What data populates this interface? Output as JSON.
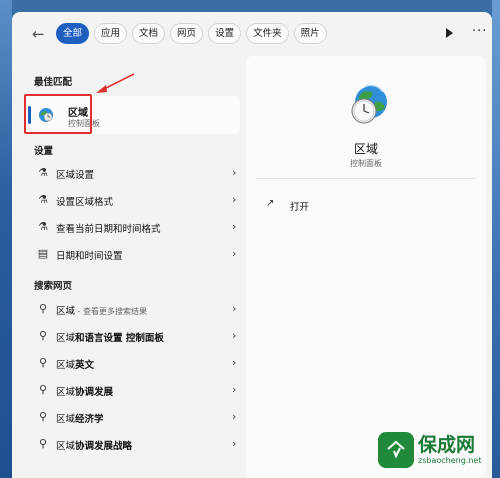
{
  "tabs": [
    "全部",
    "应用",
    "文档",
    "网页",
    "设置",
    "文件夹",
    "照片"
  ],
  "active_tab": "全部",
  "toolbar": {
    "more_label": "···"
  },
  "best_match": {
    "section_title": "最佳匹配",
    "title": "区域",
    "subtitle": "控制面板"
  },
  "settings": {
    "section_title": "设置",
    "items": [
      {
        "label": "区域设置",
        "icon": "region-settings-icon"
      },
      {
        "label": "设置区域格式",
        "icon": "region-format-icon"
      },
      {
        "label": "查看当前日期和时间格式",
        "icon": "datetime-format-icon"
      },
      {
        "label": "日期和时间设置",
        "icon": "calendar-clock-icon"
      }
    ]
  },
  "web": {
    "section_title": "搜索网页",
    "items": [
      {
        "main": "区域",
        "hint": " - 查看更多搜索结果"
      },
      {
        "main": "区域",
        "bold": "和语言设置 控制面板"
      },
      {
        "main": "区域",
        "bold": "英文"
      },
      {
        "main": "区域",
        "bold": "协调发展"
      },
      {
        "main": "区域",
        "bold": "经济学"
      },
      {
        "main": "区域",
        "bold": "协调发展战略"
      }
    ]
  },
  "detail": {
    "title": "区域",
    "subtitle": "控制面板",
    "open_label": "打开"
  },
  "watermark": {
    "text": "保成网",
    "url": "zsbaocheng.net"
  },
  "colors": {
    "accent": "#1f5fbf",
    "highlight": "#e0302b",
    "watermark": "#1e8a3a"
  }
}
